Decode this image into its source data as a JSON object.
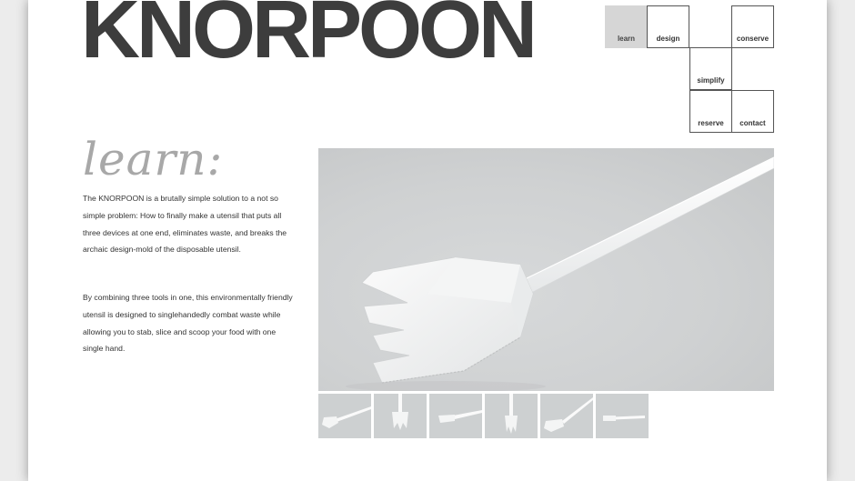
{
  "brand": {
    "logo_text": "KNORPOON"
  },
  "nav": {
    "items": [
      {
        "key": "learn",
        "label": "learn",
        "active": true
      },
      {
        "key": "design",
        "label": "design",
        "active": false
      },
      {
        "key": "conserve",
        "label": "conserve",
        "active": false
      },
      {
        "key": "simplify",
        "label": "simplify",
        "active": false
      },
      {
        "key": "reserve",
        "label": "reserve",
        "active": false
      },
      {
        "key": "contact",
        "label": "contact",
        "active": false
      }
    ]
  },
  "content": {
    "heading": "learn:",
    "paragraphs": [
      "The KNORPOON is a brutally simple solution to a not so simple problem: How to finally make a utensil that puts all three devices at one end, eliminates waste, and breaks the archaic design-mold of the disposable utensil.",
      "By combining three tools in one, this environmentally friendly utensil is designed to singlehandedly combat waste while allowing you to stab, slice and scoop your food with one single hand."
    ]
  },
  "gallery": {
    "thumbnail_count": 6
  },
  "colors": {
    "logo": "#3d3d3d",
    "heading": "#a8a8a8",
    "nav_active_bg": "#d6d6d6",
    "image_bg": "#cfd1d2"
  }
}
